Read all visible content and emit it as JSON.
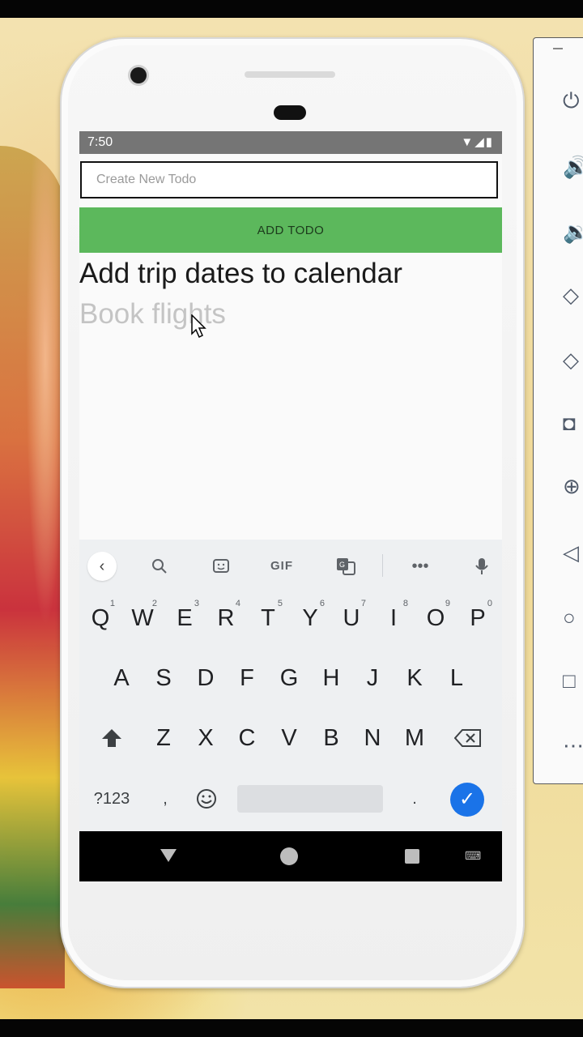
{
  "status_bar": {
    "time": "7:50",
    "icons": [
      "wifi-icon",
      "signal-icon",
      "battery-icon"
    ]
  },
  "todo_input": {
    "placeholder": "Create New Todo",
    "value": ""
  },
  "add_button": {
    "label": "ADD TODO",
    "color": "#5cb85c"
  },
  "todos": [
    {
      "text": "Add trip dates to calendar",
      "completed": false
    },
    {
      "text": "Book flights",
      "completed": true
    }
  ],
  "keyboard": {
    "suggestion_strip": [
      "back-icon",
      "search-icon",
      "sticker-icon",
      "GIF",
      "translate-icon",
      "more-icon",
      "mic-icon"
    ],
    "gif_label": "GIF",
    "row1": [
      "Q",
      "W",
      "E",
      "R",
      "T",
      "Y",
      "U",
      "I",
      "O",
      "P"
    ],
    "row1_numbers": [
      "1",
      "2",
      "3",
      "4",
      "5",
      "6",
      "7",
      "8",
      "9",
      "0"
    ],
    "row2": [
      "A",
      "S",
      "D",
      "F",
      "G",
      "H",
      "J",
      "K",
      "L"
    ],
    "row3": [
      "Z",
      "X",
      "C",
      "V",
      "B",
      "N",
      "M"
    ],
    "symbols_label": "?123",
    "comma": ",",
    "period": ".",
    "accent": "#1a73e8"
  },
  "nav_bar": [
    "back-icon",
    "home-icon",
    "recents-icon",
    "keyboard-switch-icon"
  ],
  "emulator_panel": [
    "power-icon",
    "volume-up-icon",
    "volume-down-icon",
    "rotate-left-icon",
    "rotate-right-icon",
    "camera-icon",
    "zoom-icon",
    "back-icon",
    "home-icon",
    "overview-icon",
    "more-icon"
  ]
}
